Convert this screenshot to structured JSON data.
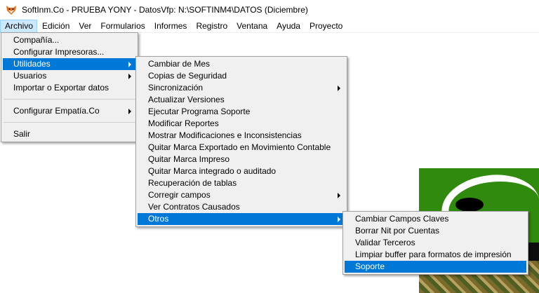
{
  "window": {
    "title": "SoftInm.Co - PRUEBA YONY - DatosVfp: N:\\SOFTINM4\\DATOS  (Diciembre)",
    "icon": "fox-icon"
  },
  "menubar": {
    "items": [
      {
        "label": "Archivo"
      },
      {
        "label": "Edición"
      },
      {
        "label": "Ver"
      },
      {
        "label": "Formularios"
      },
      {
        "label": "Informes"
      },
      {
        "label": "Registro"
      },
      {
        "label": "Ventana"
      },
      {
        "label": "Ayuda"
      },
      {
        "label": "Proyecto"
      }
    ]
  },
  "archivo_menu": {
    "items": [
      {
        "label": "Compañía..."
      },
      {
        "label": "Configurar Impresoras..."
      },
      {
        "label": "Utilidades"
      },
      {
        "label": "Usuarios"
      },
      {
        "label": "Importar o Exportar datos"
      },
      {
        "label": "Configurar Empatía.Co"
      },
      {
        "label": "Salir"
      }
    ]
  },
  "utilidades_menu": {
    "items": [
      {
        "label": "Cambiar de Mes"
      },
      {
        "label": "Copias de Seguridad"
      },
      {
        "label": "Sincronización"
      },
      {
        "label": "Actualizar Versiones"
      },
      {
        "label": "Ejecutar Programa Soporte"
      },
      {
        "label": "Modificar Reportes"
      },
      {
        "label": "Mostrar Modificaciones e Inconsistencias"
      },
      {
        "label": "Quitar Marca Exportado en Movimiento Contable"
      },
      {
        "label": "Quitar Marca Impreso"
      },
      {
        "label": "Quitar Marca integrado o auditado"
      },
      {
        "label": "Recuperación de tablas"
      },
      {
        "label": "Corregir campos"
      },
      {
        "label": "Ver Contratos Causados"
      },
      {
        "label": "Otros"
      }
    ]
  },
  "otros_menu": {
    "items": [
      {
        "label": "Cambiar Campos Claves"
      },
      {
        "label": "Borrar Nit por Cuentas"
      },
      {
        "label": "Validar Terceros"
      },
      {
        "label": "Limpiar buffer para formatos de impresión"
      },
      {
        "label": "Soporte"
      }
    ]
  },
  "colors": {
    "highlight": "#0078d7",
    "menu_bg": "#f0f0f0",
    "menubar_open": "#cce8ff",
    "background_logo_green": "#2f8a0d"
  }
}
